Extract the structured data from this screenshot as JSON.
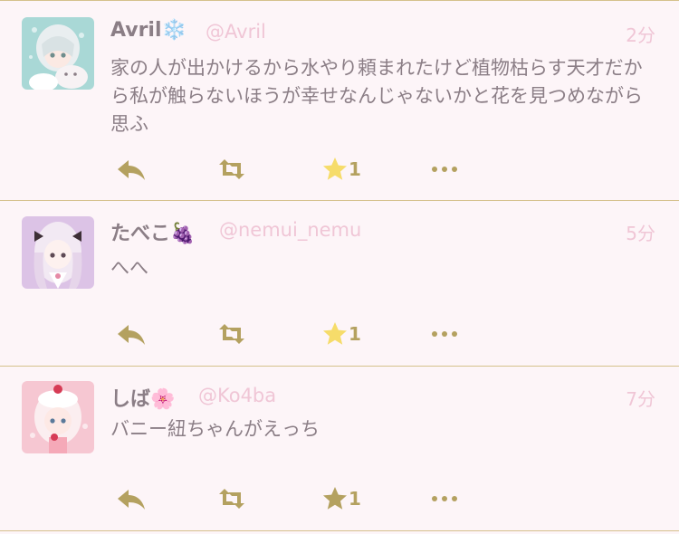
{
  "colors": {
    "background": "#fdf5f8",
    "divider": "#d5c18c",
    "name": "#8b7e86",
    "handle": "#f0c6d6",
    "text": "#8b7e86",
    "icon": "#b4a160",
    "star_active": "#f6dc6a"
  },
  "tweets": [
    {
      "name": "Avril❄️",
      "handle": "@Avril",
      "time": "2分",
      "text": "家の人が出かけるから水やり頼まれたけど植物枯らす天才だから私が触らないほうが幸せなんじゃないかと花を見つめながら思ふ",
      "fav_count": "1",
      "favorited": true,
      "avatar_icon": "avatar-avril-icon"
    },
    {
      "name": "たべこ🍇",
      "handle": "@nemui_nemu",
      "time": "5分",
      "text": "へへ",
      "fav_count": "1",
      "favorited": true,
      "avatar_icon": "avatar-tabeko-icon"
    },
    {
      "name": "しば🌸",
      "handle": "@Ko4ba",
      "time": "7分",
      "text": "バニー紐ちゃんがえっち",
      "fav_count": "1",
      "favorited": false,
      "avatar_icon": "avatar-shiba-icon"
    }
  ]
}
